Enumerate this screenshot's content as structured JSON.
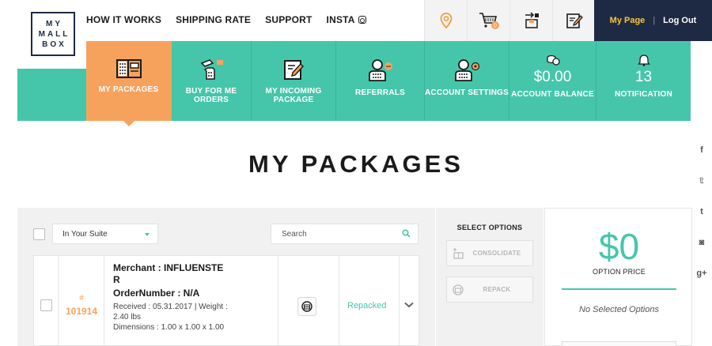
{
  "logo": {
    "lines": [
      "MY",
      "MALL",
      "BOX"
    ]
  },
  "nav": [
    {
      "label": "HOW IT WORKS"
    },
    {
      "label": "SHIPPING RATE"
    },
    {
      "label": "SUPPORT"
    },
    {
      "label": "INSTA"
    }
  ],
  "header_icons": {
    "items": [
      {
        "name": "location-pin-icon"
      },
      {
        "name": "cart-icon",
        "badge": "0"
      },
      {
        "name": "package-transfer-icon"
      },
      {
        "name": "edit-note-icon"
      }
    ]
  },
  "user": {
    "my_page": "My Page",
    "separator": "|",
    "logout": "Log Out"
  },
  "tabs": [
    {
      "label": "MY PACKAGES",
      "icon": "packages-icon",
      "active": true
    },
    {
      "label": "BUY FOR ME ORDERS",
      "icon": "buy-for-me-icon"
    },
    {
      "label": "MY INCOMING PACKAGE",
      "icon": "incoming-package-icon"
    },
    {
      "label": "REFERRALS",
      "icon": "referrals-icon"
    },
    {
      "label": "ACCOUNT SETTINGS",
      "icon": "account-settings-icon"
    },
    {
      "label": "ACCOUNT BALANCE",
      "value": "$0.00",
      "icon": "coins-icon"
    },
    {
      "label": "NOTIFICATION",
      "value": "13",
      "icon": "bell-icon"
    }
  ],
  "page": {
    "title": "MY PACKAGES"
  },
  "social": [
    {
      "name": "facebook-icon",
      "glyph": "f"
    },
    {
      "name": "twitter-icon",
      "glyph": "𝕥"
    },
    {
      "name": "tumblr-icon",
      "glyph": "t"
    },
    {
      "name": "instagram-icon",
      "glyph": "◙"
    },
    {
      "name": "google-plus-icon",
      "glyph": "g+"
    }
  ],
  "filter": {
    "selected": "In Your Suite"
  },
  "search": {
    "placeholder": "Search"
  },
  "package": {
    "hash": "#",
    "id": "101914",
    "merchant": "Merchant : INFLUENSTER",
    "order_number": "OrderNumber : N/A",
    "received": "Received : 05.31.2017  |  Weight : 2.40 lbs",
    "dimensions": "Dimensions : 1.00 x 1.00 x 1.00",
    "status": "Repacked"
  },
  "options": {
    "title": "SELECT OPTIONS",
    "consolidate": "CONSOLIDATE",
    "repack": "REPACK"
  },
  "price": {
    "value": "$0",
    "label": "OPTION PRICE",
    "none": "No Selected Options"
  },
  "colors": {
    "teal": "#45c6aa",
    "orange": "#f7a25c",
    "navy": "#1e2a44",
    "yellow": "#f5c542"
  }
}
